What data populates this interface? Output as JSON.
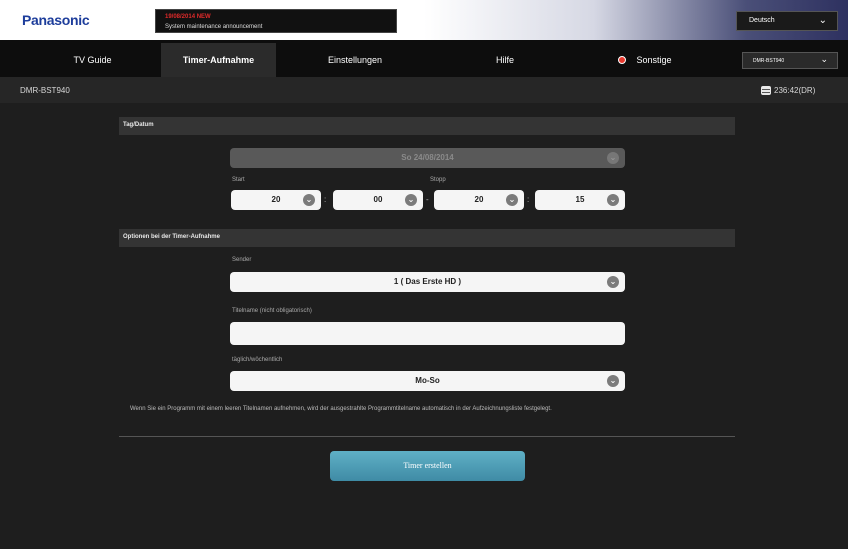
{
  "brand": "Panasonic",
  "notice": {
    "date": "19/08/2014 NEW",
    "text": "System maintenance announcement"
  },
  "language": "Deutsch",
  "device_select": "DMR-BST940",
  "tabs": [
    "TV Guide",
    "Timer-Aufnahme",
    "Einstellungen",
    "Hilfe",
    "Sonstige"
  ],
  "active_tab": "Timer-Aufnahme",
  "model": "DMR-BST940",
  "disk_remaining": "236:42(DR)",
  "form": {
    "section_date": "Tag/Datum",
    "date_value": "So 24/08/2014",
    "start_label": "Start",
    "stop_label": "Stopp",
    "start_hour": "20",
    "start_minute": "00",
    "stop_hour": "20",
    "stop_minute": "15",
    "time_separator": ":",
    "range_separator": "-",
    "section_options": "Optionen bei der Timer-Aufnahme",
    "channel_label": "Sender",
    "channel_value": "1 ( Das Erste HD )",
    "title_label": "Titelname (nicht obligatorisch)",
    "title_value": "",
    "repeat_label": "täglich/wöchentlich",
    "repeat_value": "Mo-So",
    "note": "Wenn Sie ein Programm mit einem leeren Titelnamen aufnehmen, wird der ausgestrahlte Programmtitelname automatisch in der Aufzeichnungsliste festgelegt."
  },
  "submit_label": "Timer erstellen"
}
